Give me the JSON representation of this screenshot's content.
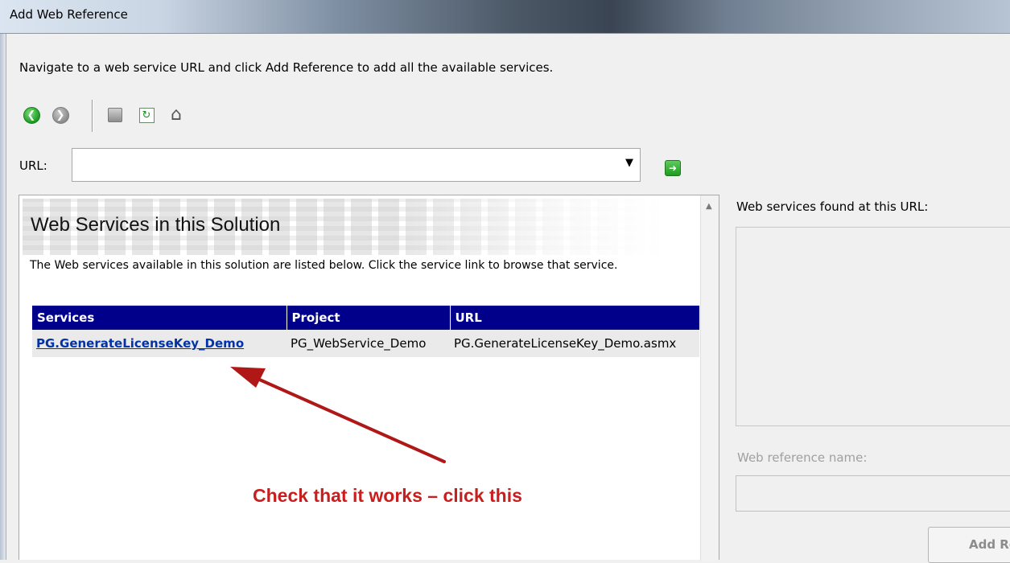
{
  "window": {
    "title": "Add Web Reference"
  },
  "instructions": "Navigate to a web service URL and click Add Reference to add all the available services.",
  "toolbar": {
    "back_icon": "back-arrow-icon",
    "forward_icon": "forward-arrow-icon",
    "stop_icon": "stop-icon",
    "refresh_icon": "refresh-icon",
    "home_icon": "home-icon"
  },
  "url_bar": {
    "label": "URL:",
    "value": "",
    "go_icon": "go-arrow-icon"
  },
  "browser": {
    "heading": "Web Services in this Solution",
    "description": "The Web services available in this solution are listed below. Click the service link to browse that service.",
    "table": {
      "headers": [
        "Services",
        "Project",
        "URL"
      ],
      "rows": [
        [
          "PG.GenerateLicenseKey_Demo",
          "PG_WebService_Demo",
          "PG.GenerateLicenseKey_Demo.asmx"
        ]
      ]
    }
  },
  "annotation": {
    "text": "Check that it works – click this",
    "color": "#c81e1e"
  },
  "right_panel": {
    "found_label": "Web services found at this URL:",
    "ref_name_label": "Web reference name:",
    "ref_name_value": "",
    "add_button": "Add Reference"
  },
  "colors": {
    "table_header": "#00008b",
    "link": "#0033aa"
  }
}
